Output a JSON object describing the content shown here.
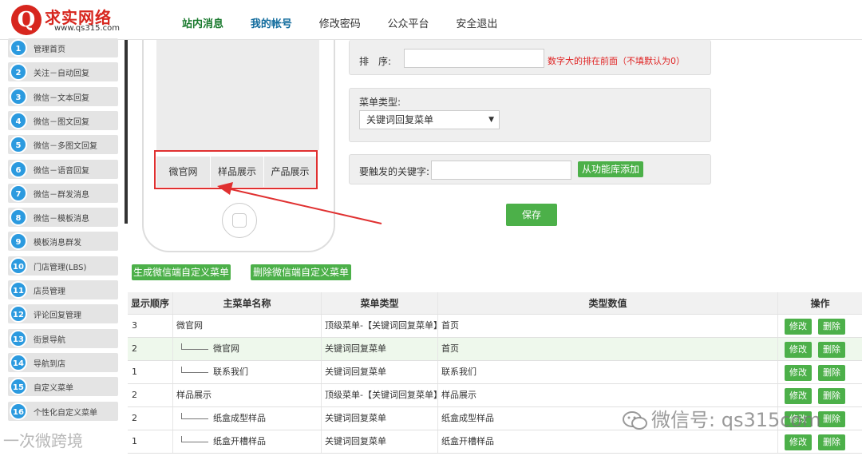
{
  "header": {
    "logo_name": "求实网络",
    "logo_url": "www.qs315.com",
    "nav": [
      "站内消息",
      "我的帐号",
      "修改密码",
      "公众平台",
      "安全退出"
    ]
  },
  "sidebar": {
    "items": [
      {
        "num": "1",
        "label": "管理首页"
      },
      {
        "num": "2",
        "label": "关注－自动回复"
      },
      {
        "num": "3",
        "label": "微信－文本回复"
      },
      {
        "num": "4",
        "label": "微信－图文回复"
      },
      {
        "num": "5",
        "label": "微信－多图文回复"
      },
      {
        "num": "6",
        "label": "微信－语音回复"
      },
      {
        "num": "7",
        "label": "微信－群发消息"
      },
      {
        "num": "8",
        "label": "微信－模板消息"
      },
      {
        "num": "9",
        "label": "模板消息群发"
      },
      {
        "num": "10",
        "label": "门店管理(LBS)"
      },
      {
        "num": "11",
        "label": "店员管理"
      },
      {
        "num": "12",
        "label": "评论回复管理"
      },
      {
        "num": "13",
        "label": "街景导航"
      },
      {
        "num": "14",
        "label": "导航到店"
      },
      {
        "num": "15",
        "label": "自定义菜单"
      },
      {
        "num": "16",
        "label": "个性化自定义菜单"
      }
    ]
  },
  "phone_menu": [
    "微官网",
    "样品展示",
    "产品展示"
  ],
  "form": {
    "sort_label": "排　序:",
    "sort_value": "",
    "sort_hint": "数字大的排在前面（不填默认为0）",
    "menu_type_label": "菜单类型:",
    "menu_type_value": "关键词回复菜单",
    "keyword_label": "要触发的关键字:",
    "keyword_value": "",
    "add_from_library": "从功能库添加",
    "save": "保存"
  },
  "actions": {
    "generate": "生成微信端自定义菜单",
    "delete": "删除微信端自定义菜单"
  },
  "table": {
    "headers": [
      "显示顺序",
      "主菜单名称",
      "菜单类型",
      "类型数值",
      "操作"
    ],
    "edit_label": "修改",
    "delete_label": "删除",
    "rows": [
      {
        "order": "3",
        "name": "微官网",
        "child": false,
        "type": "顶级菜单-【关键词回复菜单】",
        "value": "首页"
      },
      {
        "order": "2",
        "name": "微官网",
        "child": true,
        "type": "关键词回复菜单",
        "value": "首页"
      },
      {
        "order": "1",
        "name": "联系我们",
        "child": true,
        "type": "关键词回复菜单",
        "value": "联系我们"
      },
      {
        "order": "2",
        "name": "样品展示",
        "child": false,
        "type": "顶级菜单-【关键词回复菜单】",
        "value": "样品展示"
      },
      {
        "order": "2",
        "name": "纸盒成型样品",
        "child": true,
        "type": "关键词回复菜单",
        "value": "纸盒成型样品"
      },
      {
        "order": "1",
        "name": "纸盒开槽样品",
        "child": true,
        "type": "关键词回复菜单",
        "value": "纸盒开槽样品"
      }
    ]
  },
  "watermarks": {
    "right": "微信号: qs315com",
    "left": "一次微跨境"
  },
  "colors": {
    "accent_green": "#4cb049",
    "sidebar_badge": "#2b9adf",
    "hint_red": "#e02424",
    "logo_red": "#d7261e"
  }
}
